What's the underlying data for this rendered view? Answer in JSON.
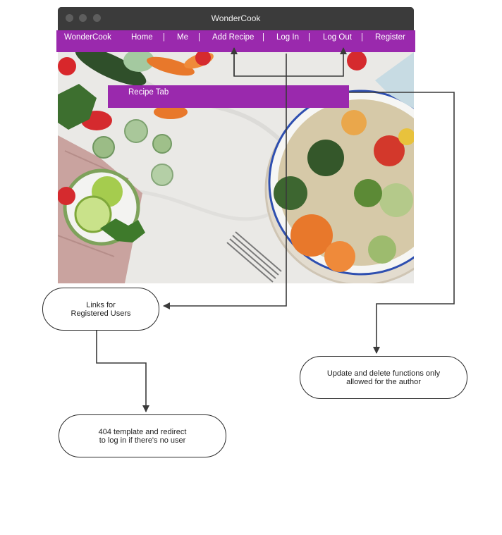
{
  "window": {
    "title": "WonderCook"
  },
  "nav": {
    "items": [
      {
        "label": "WonderCook"
      },
      {
        "label": "Home"
      },
      {
        "label": "Me"
      },
      {
        "label": "Add Recipe"
      },
      {
        "label": "Log In"
      },
      {
        "label": "Log Out"
      },
      {
        "label": "Register"
      }
    ],
    "separator": "|"
  },
  "recipe_tab": {
    "label": "Recipe Tab"
  },
  "notes": {
    "registered_links": "Links for\nRegistered Users",
    "not_found": "404 template and redirect\nto log in if there's no user",
    "author_only": "Update and delete functions only\nallowed for the author"
  },
  "colors": {
    "accent": "#9a29ad",
    "titlebar": "#3b3b3b",
    "connector": "#3a3a3a"
  },
  "icons": {
    "window_controls": "traffic-light-dots",
    "photo": "food-flatlay-photo"
  }
}
